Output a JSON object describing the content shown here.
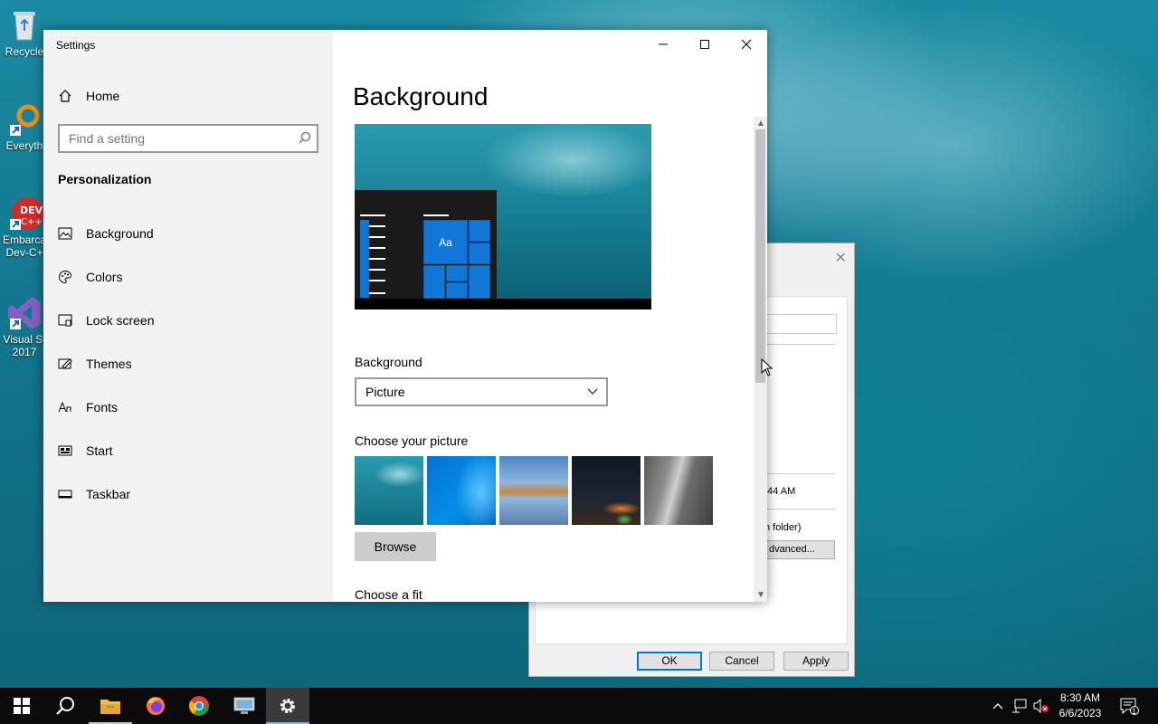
{
  "desktop": {
    "icons": [
      {
        "label": "Recycle"
      },
      {
        "label": "Everyth"
      },
      {
        "label": "Embarca",
        "label2": "Dev-C+"
      },
      {
        "label": "Visual St",
        "label2": "2017"
      }
    ]
  },
  "settings": {
    "window_title": "Settings",
    "home_label": "Home",
    "search_placeholder": "Find a setting",
    "section_heading": "Personalization",
    "nav_items": [
      {
        "label": "Background",
        "icon": "picture-icon"
      },
      {
        "label": "Colors",
        "icon": "palette-icon"
      },
      {
        "label": "Lock screen",
        "icon": "lock-screen-icon"
      },
      {
        "label": "Themes",
        "icon": "themes-icon"
      },
      {
        "label": "Fonts",
        "icon": "fonts-icon"
      },
      {
        "label": "Start",
        "icon": "start-icon"
      },
      {
        "label": "Taskbar",
        "icon": "taskbar-icon"
      }
    ],
    "page_title": "Background",
    "preview_tile_text": "Aa",
    "background_label": "Background",
    "background_value": "Picture",
    "choose_picture_label": "Choose your picture",
    "browse_label": "Browse",
    "choose_fit_label": "Choose a fit"
  },
  "behind_dialog": {
    "time_fragment": ":44 AM",
    "folder_fragment": "n folder)",
    "advanced_fragment": "dvanced...",
    "ok_label": "OK",
    "cancel_label": "Cancel",
    "apply_label": "Apply"
  },
  "taskbar": {
    "time": "8:30 AM",
    "date": "6/6/2023",
    "notification_count": "1"
  },
  "colors": {
    "accent": "#0078d7",
    "tile_blue": "#1177d6"
  }
}
